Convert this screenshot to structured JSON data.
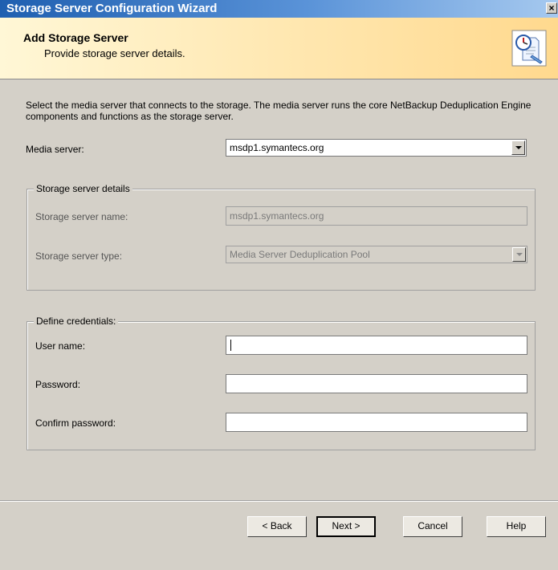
{
  "window": {
    "title": "Storage Server Configuration Wizard",
    "close_glyph": "×"
  },
  "header": {
    "title": "Add Storage Server",
    "subtitle": "Provide storage server details.",
    "icon": "wizard-document-clock-icon"
  },
  "description": "Select the media server that connects to the storage. The media server runs the core NetBackup Deduplication Engine components and functions as the storage server.",
  "media_server": {
    "label": "Media server:",
    "value": "msdp1.symantecs.org"
  },
  "storage_details": {
    "legend": "Storage server details",
    "name_label": "Storage server name:",
    "name_value": "msdp1.symantecs.org",
    "type_label": "Storage server type:",
    "type_value": "Media Server Deduplication Pool"
  },
  "credentials": {
    "legend": "Define credentials:",
    "username_label": "User name:",
    "username_value": "",
    "password_label": "Password:",
    "password_value": "",
    "confirm_label": "Confirm password:",
    "confirm_value": ""
  },
  "buttons": {
    "back": "< Back",
    "next": "Next >",
    "cancel": "Cancel",
    "help": "Help"
  }
}
